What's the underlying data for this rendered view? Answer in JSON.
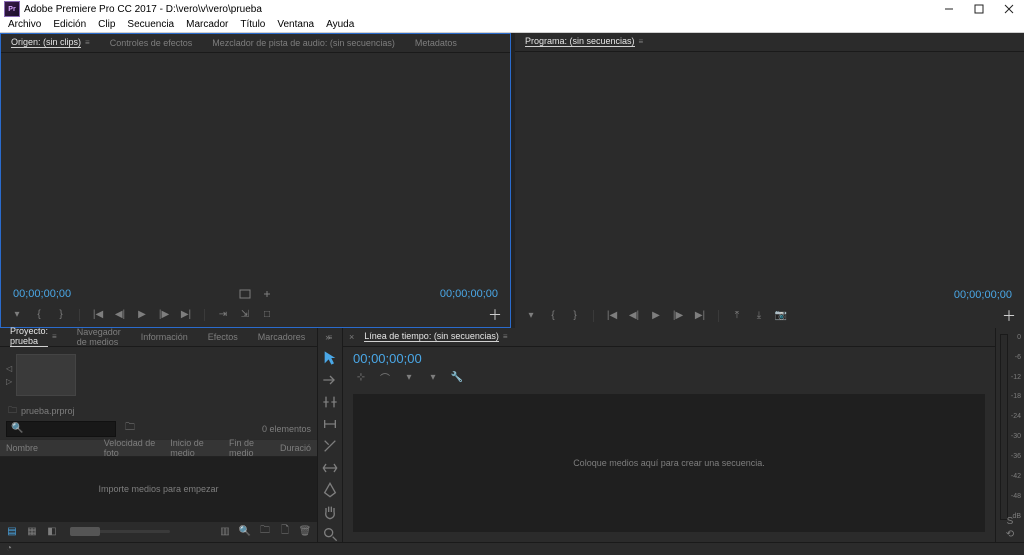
{
  "window": {
    "appicon_text": "Pr",
    "title": "Adobe Premiere Pro CC 2017 - D:\\vero\\v\\vero\\prueba"
  },
  "menu": {
    "items": [
      "Archivo",
      "Edición",
      "Clip",
      "Secuencia",
      "Marcador",
      "Título",
      "Ventana",
      "Ayuda"
    ]
  },
  "source": {
    "tabs": {
      "origen": "Origen: (sin clips)",
      "efectos": "Controles de efectos",
      "mezclador": "Mezclador de pista de audio: (sin secuencias)",
      "metadatos": "Metadatos"
    },
    "tc_left": "00;00;00;00",
    "tc_right": "00;00;00;00"
  },
  "program": {
    "tab": "Programa: (sin secuencias)",
    "tc_right": "00;00;00;00"
  },
  "project": {
    "tabs": {
      "proyecto": "Proyecto: prueba",
      "navegador": "Navegador de medios",
      "info": "Información",
      "efectos": "Efectos",
      "marcadores": "Marcadores"
    },
    "bin_label": "prueba.prproj",
    "search_placeholder": "",
    "item_count": "0 elementos",
    "cols": {
      "nombre": "Nombre",
      "velocidad": "Velocidad de foto",
      "inicio": "Inicio de medio",
      "fin": "Fin de medio",
      "duracion": "Duració"
    },
    "dropzone": "Importe medios para empezar"
  },
  "timeline": {
    "tab": "Línea de tiempo: (sin secuencias)",
    "tc": "00;00;00;00",
    "dropzone": "Coloque medios aquí para crear una secuencia."
  },
  "meters": {
    "scale": [
      "0",
      "-6",
      "-12",
      "-18",
      "-24",
      "-30",
      "-36",
      "-42",
      "-48",
      "dB"
    ]
  },
  "colors": {
    "accent": "#2a6bcc",
    "tc": "#4aa7e6"
  }
}
